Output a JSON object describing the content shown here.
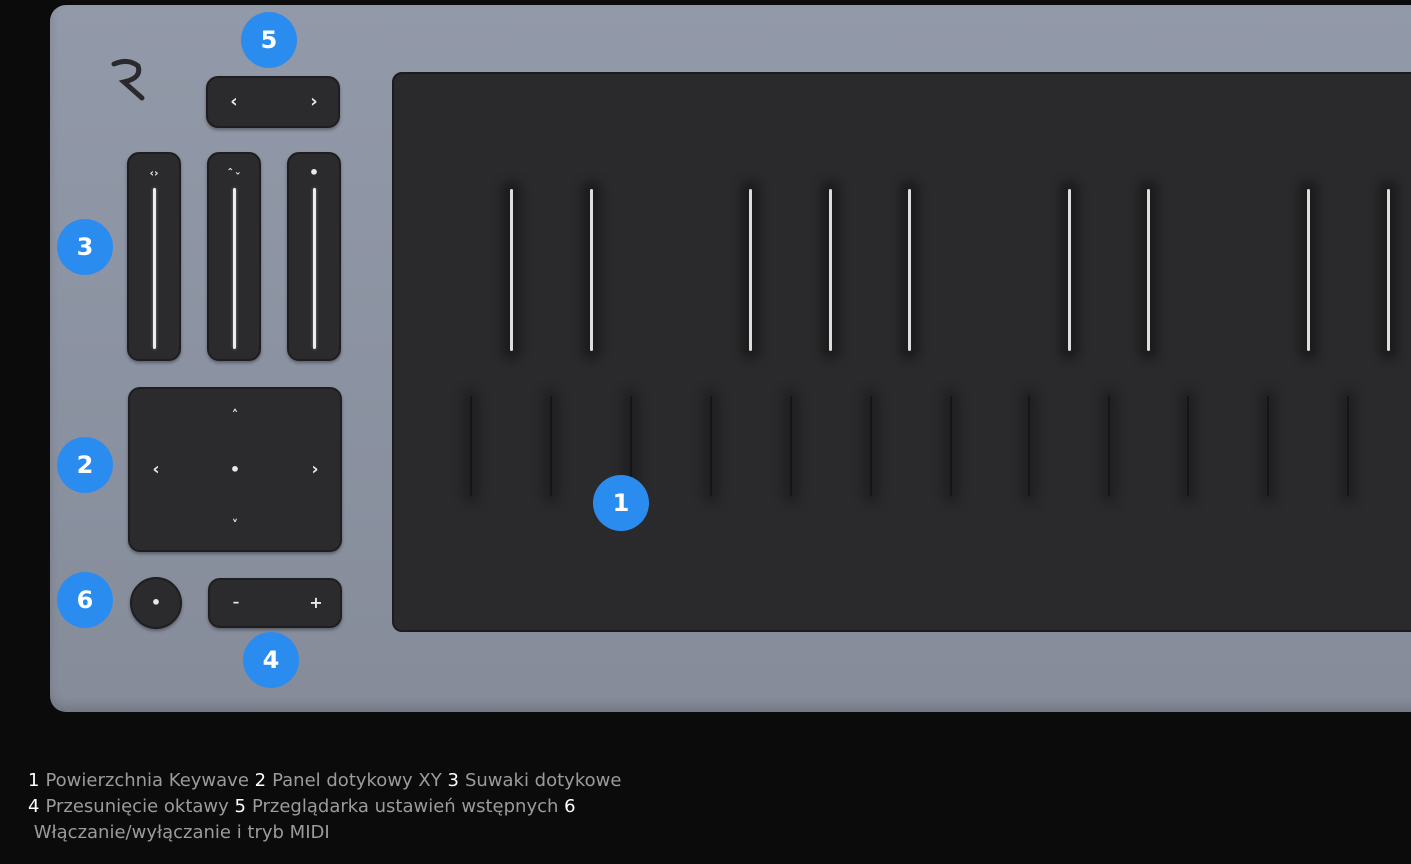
{
  "colors": {
    "badge": "#2b8cf0",
    "device": "#8e95a4",
    "surface": "#2a2a2c",
    "background": "#0b0b0c"
  },
  "brand": {
    "logo_letter": "R"
  },
  "controls": {
    "preset_prev": "‹",
    "preset_next": "›",
    "slider_icons": [
      "‹›",
      "⌃⌄",
      "•"
    ],
    "xy_up": "˄",
    "xy_left": "‹",
    "xy_center": "•",
    "xy_right": "›",
    "xy_down": "˅",
    "power_dot": "•",
    "octave_minus": "–",
    "octave_plus": "+"
  },
  "badges": {
    "keywave": "1",
    "xy": "2",
    "sliders": "3",
    "octave": "4",
    "presets": "5",
    "power": "6"
  },
  "legend": [
    {
      "num": "1",
      "label": "Powierzchnia Keywave"
    },
    {
      "num": "2",
      "label": "Panel dotykowy XY"
    },
    {
      "num": "3",
      "label": "Suwaki dotykowe"
    },
    {
      "num": "4",
      "label": "Przesunięcie oktawy"
    },
    {
      "num": "5",
      "label": "Przeglądarka ustawień wstępnych"
    },
    {
      "num": "6",
      "label": "Włączanie/wyłączanie i tryb MIDI"
    }
  ]
}
